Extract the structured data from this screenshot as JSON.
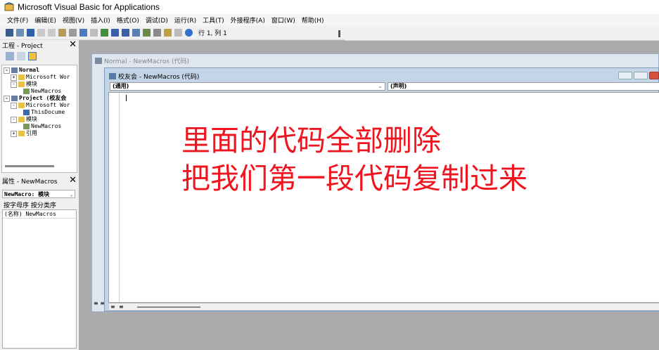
{
  "title_bar": {
    "title": "Microsoft Visual Basic for Applications"
  },
  "menu": {
    "items": [
      "文件(F)",
      "编辑(E)",
      "视图(V)",
      "插入(I)",
      "格式(O)",
      "调试(D)",
      "运行(R)",
      "工具(T)",
      "外接程序(A)",
      "窗口(W)",
      "帮助(H)"
    ]
  },
  "toolbar": {
    "position": "行 1, 列 1"
  },
  "project_pane": {
    "title": "工程 - Project",
    "tree": [
      {
        "label": "Normal"
      },
      {
        "label": "Microsoft Wor"
      },
      {
        "label": "模块"
      },
      {
        "label": "NewMacros"
      },
      {
        "label": "Project (校友会"
      },
      {
        "label": "Microsoft Wor"
      },
      {
        "label": "ThisDocume"
      },
      {
        "label": "模块"
      },
      {
        "label": "NewMacros"
      },
      {
        "label": "引用"
      }
    ]
  },
  "properties_pane": {
    "title": "属性 - NewMacros",
    "object": "NewMacro: 模块",
    "tabs": "按字母序  按分类序",
    "row_name": "(名称) NewMacros"
  },
  "back_window": {
    "title": "Normal - NewMacros (代码)"
  },
  "front_window": {
    "title": "校友会 - NewMacros (代码)",
    "left_combo": "(通用)",
    "right_combo": "(声明)"
  },
  "overlay": {
    "line1": "里面的代码全部删除",
    "line2": "把我们第一段代码复制过来"
  },
  "colors": {
    "overlay_text": "#f0141e",
    "workspace": "#ababab"
  }
}
